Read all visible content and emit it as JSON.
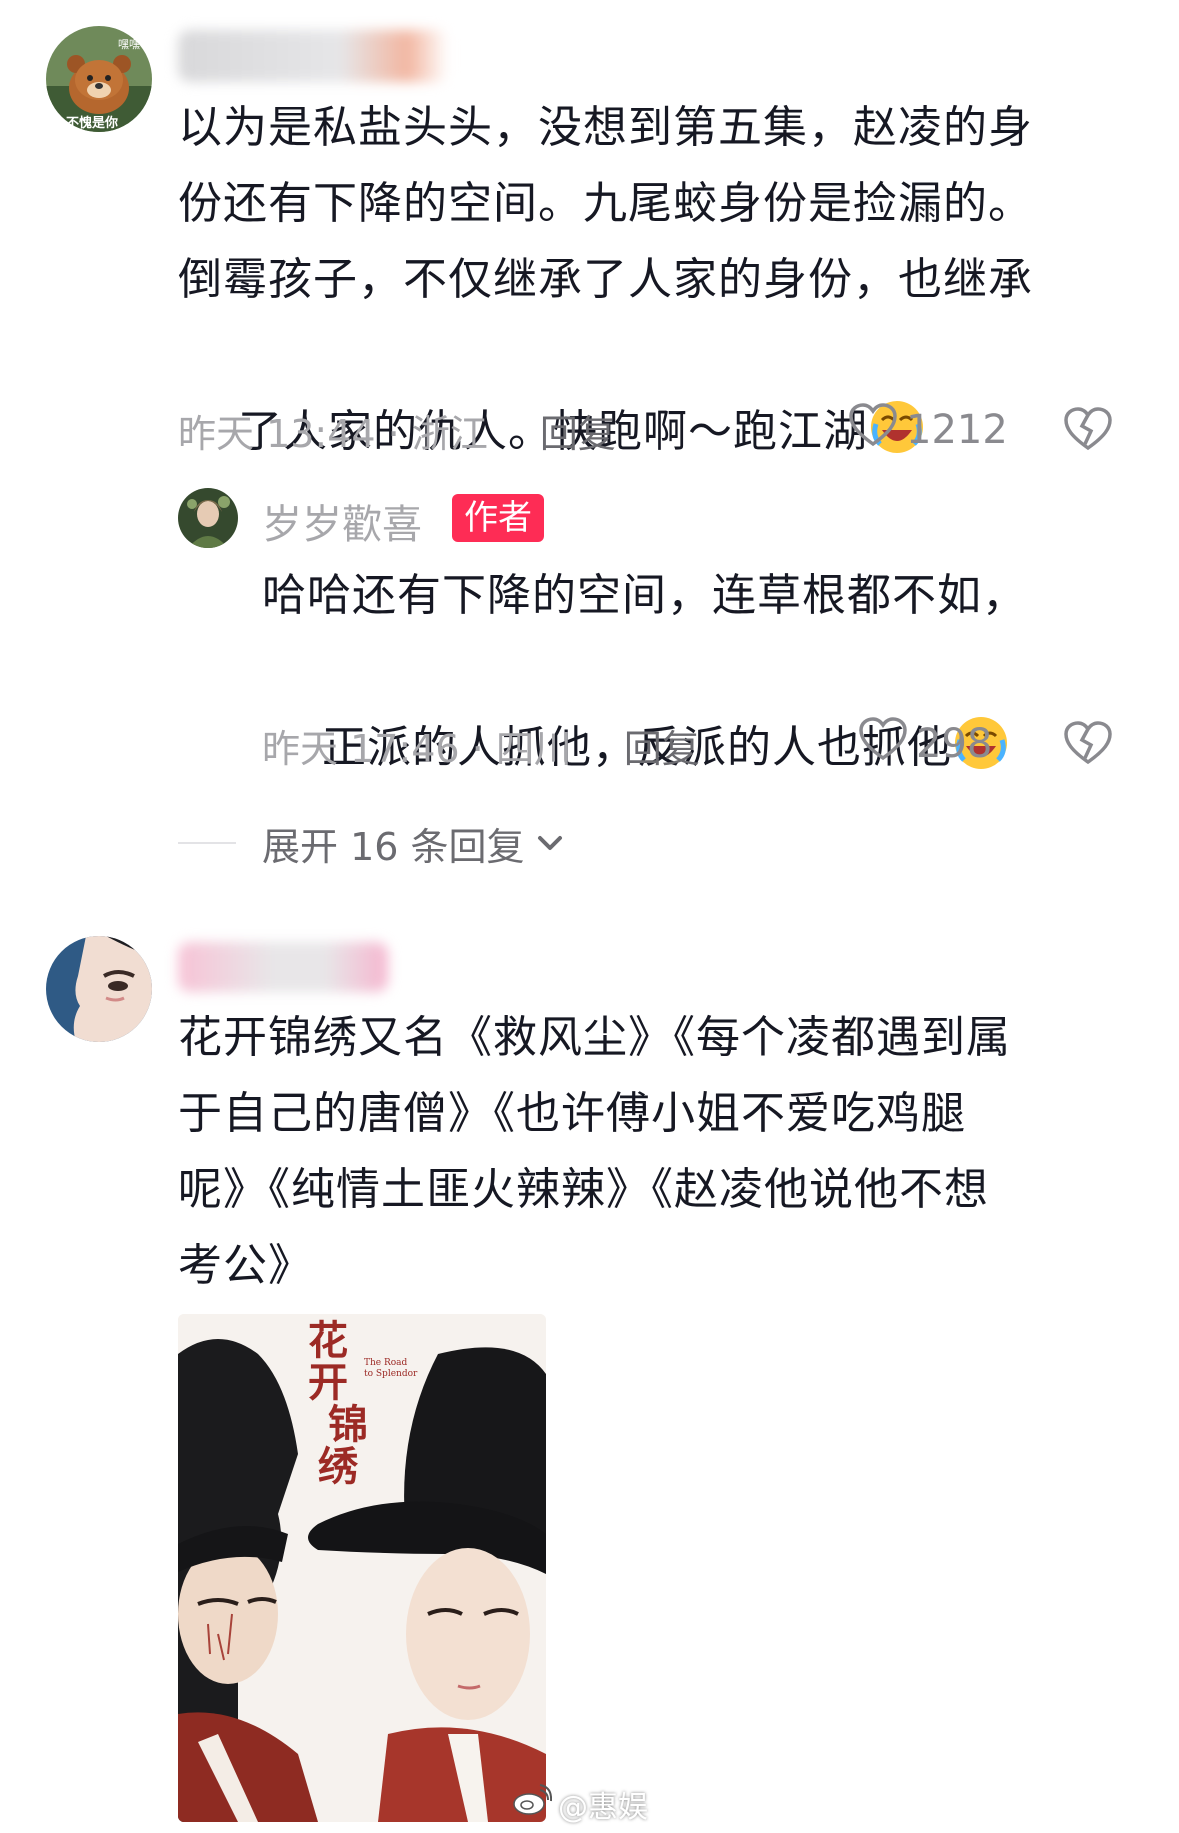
{
  "comments": [
    {
      "text": "以为是私盐头头，没想到第五集，赵凌的身份还有下降的空间。九尾蛟身份是捡漏的。倒霉孩子，不仅继承了人家的身份，也继承了人家的仇人。快跑啊～跑江湖",
      "line1": "以为是私盐头头，没想到第五集，赵凌的身",
      "line2": "份还有下降的空间。九尾蛟身份是捡漏的。",
      "line3": "倒霉孩子，不仅继承了人家的身份，也继承",
      "line4": "了人家的仇人。快跑啊～跑江湖",
      "emoji": "laughing-crying-emoji",
      "time": "昨天 13:44 · 浙江",
      "reply_label": "回复",
      "likes": "1212",
      "avatar_text_top": "嘿嘿",
      "avatar_text_bottom": "不愧是你"
    },
    {
      "text": "花开锦绣又名《救风尘》《每个凌都遇到属于自己的唐僧》《也许傅小姐不爱吃鸡腿呢》《纯情土匪火辣辣》《赵凌他说他不想考公》",
      "line1": "花开锦绣又名《救风尘》《每个凌都遇到属",
      "line2": "于自己的唐僧》《也许傅小姐不爱吃鸡腿",
      "line3": "呢》《纯情土匪火辣辣》《赵凌他说他不想",
      "line4": "考公》"
    }
  ],
  "reply": {
    "author": "岁岁歡喜",
    "badge": "作者",
    "line1": "哈哈还有下降的空间，连草根都不如，",
    "line2": "正派的人抓他，反派的人也抓他",
    "emoji": "laughing-crying-emoji",
    "time": "昨天 17:46 · 四川",
    "reply_label": "回复",
    "likes": "298"
  },
  "expand": {
    "label": "展开 16 条回复",
    "icon": "chevron-down-icon"
  },
  "poster": {
    "title_chars": [
      "花",
      "开",
      "锦",
      "绣"
    ],
    "subtitle_en_1": "The Road",
    "subtitle_en_2": "to Splendor"
  },
  "watermark": {
    "text": "@惠娱",
    "icon": "weibo-icon"
  },
  "colors": {
    "badge": "#fe2c55",
    "text": "#161823",
    "meta": "#a7a7ab",
    "reply": "#6b6b70"
  }
}
